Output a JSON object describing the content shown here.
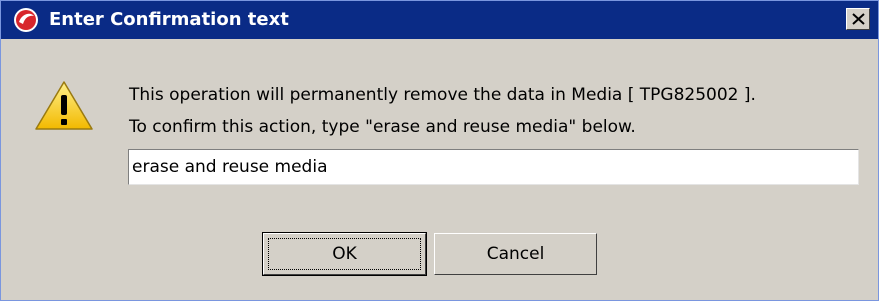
{
  "window": {
    "title": "Enter Confirmation text",
    "icon": "app-logo-icon",
    "close_icon": "close-icon"
  },
  "message": {
    "icon": "warning-icon",
    "line1": "This operation will permanently remove the data in Media [ TPG825002 ].",
    "line2": "To confirm this action, type \"erase and reuse media\" below."
  },
  "input": {
    "value": "erase and reuse media",
    "placeholder": ""
  },
  "buttons": {
    "ok_label": "OK",
    "cancel_label": "Cancel"
  },
  "colors": {
    "titlebar": "#0a2b86",
    "dialog_bg": "#d4d0c8",
    "warning": "#f5c400"
  }
}
